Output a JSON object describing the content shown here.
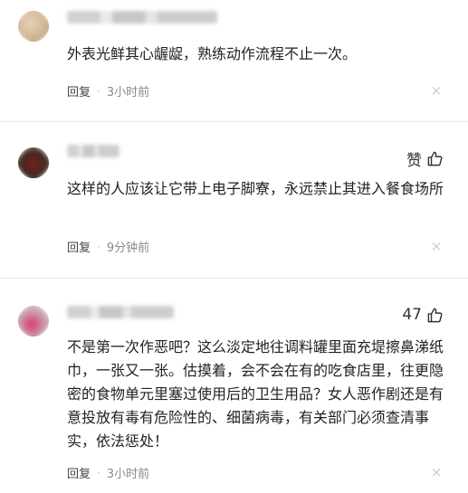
{
  "comments": [
    {
      "text": "外表光鲜其心龌龊，熟练动作流程不止一次。",
      "reply_label": "回复",
      "separator": "·",
      "time": "3小时前",
      "close_symbol": "×",
      "like_label": ""
    },
    {
      "text": "这样的人应该让它带上电子脚寮，永远禁止其进入餐食场所",
      "reply_label": "回复",
      "separator": "·",
      "time": "9分钟前",
      "close_symbol": "×",
      "like_label": "赞"
    },
    {
      "text": "不是第一次作恶吧？这么淡定地往调料罐里面充堤擦鼻涕纸巾，一张又一张。估摸着，会不会在有的吃食店里，往更隐密的食物单元里塞过使用后的卫生用品？女人恶作剧还是有意投放有毒有危险性的、细菌病毒，有关部门必须查清事实，依法惩处！",
      "reply_label": "回复",
      "separator": "·",
      "time": "3小时前",
      "close_symbol": "×",
      "like_label": "47"
    }
  ],
  "icons": {
    "thumb": "thumbs-up-icon",
    "close": "close-icon"
  }
}
